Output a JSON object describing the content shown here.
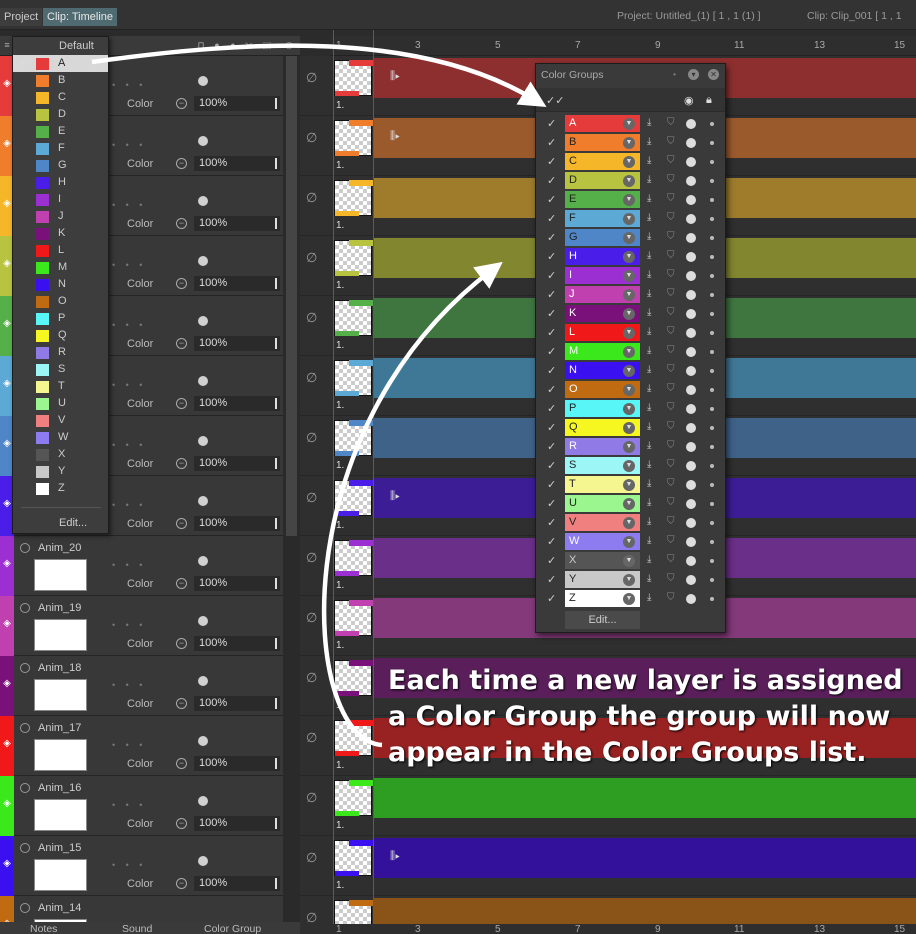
{
  "topbar": {
    "tabs": [
      "Project",
      "Clip: Timeline"
    ],
    "project_info": "Project: Untitled_(1) [ 1 , 1  (1) ]",
    "clip_info": "Clip: Clip_001 [ 1 , 1"
  },
  "ruler": {
    "ticks": [
      "1",
      "3",
      "5",
      "7",
      "9",
      "11",
      "13",
      "15"
    ]
  },
  "dropdown": {
    "default_label": "Default",
    "selected": "A",
    "items": [
      {
        "label": "A",
        "color": "#e53b3b"
      },
      {
        "label": "B",
        "color": "#f07d2b"
      },
      {
        "label": "C",
        "color": "#f5b62a"
      },
      {
        "label": "D",
        "color": "#b8c440"
      },
      {
        "label": "E",
        "color": "#56b04a"
      },
      {
        "label": "F",
        "color": "#5ba9d4"
      },
      {
        "label": "G",
        "color": "#4f86c7"
      },
      {
        "label": "H",
        "color": "#4a1ee8"
      },
      {
        "label": "I",
        "color": "#9b2fd1"
      },
      {
        "label": "J",
        "color": "#c040b0"
      },
      {
        "label": "K",
        "color": "#7a107a"
      },
      {
        "label": "L",
        "color": "#f01818"
      },
      {
        "label": "M",
        "color": "#3be81b"
      },
      {
        "label": "N",
        "color": "#3a10f0"
      },
      {
        "label": "O",
        "color": "#c06a12"
      },
      {
        "label": "P",
        "color": "#58f6f6"
      },
      {
        "label": "Q",
        "color": "#f6f620"
      },
      {
        "label": "R",
        "color": "#8f7ae6"
      },
      {
        "label": "S",
        "color": "#9cf6f6"
      },
      {
        "label": "T",
        "color": "#f6f690"
      },
      {
        "label": "U",
        "color": "#9cf690"
      },
      {
        "label": "V",
        "color": "#f08080"
      },
      {
        "label": "W",
        "color": "#8c7cf0"
      },
      {
        "label": "X",
        "color": "#555555"
      },
      {
        "label": "Y",
        "color": "#c8c8c8"
      },
      {
        "label": "Z",
        "color": "#ffffff"
      }
    ],
    "edit_label": "Edit..."
  },
  "layers": [
    {
      "name": "",
      "color": "#e53b3b",
      "blend": "Color",
      "opacity": "100%"
    },
    {
      "name": "",
      "color": "#f07d2b",
      "blend": "Color",
      "opacity": "100%"
    },
    {
      "name": "",
      "color": "#f5b62a",
      "blend": "Color",
      "opacity": "100%"
    },
    {
      "name": "",
      "color": "#b8c440",
      "blend": "Color",
      "opacity": "100%"
    },
    {
      "name": "",
      "color": "#56b04a",
      "blend": "Color",
      "opacity": "100%"
    },
    {
      "name": "",
      "color": "#5ba9d4",
      "blend": "Color",
      "opacity": "100%"
    },
    {
      "name": "",
      "color": "#4f86c7",
      "blend": "Color",
      "opacity": "100%"
    },
    {
      "name": "",
      "color": "#4a1ee8",
      "blend": "Color",
      "opacity": "100%"
    },
    {
      "name": "Anim_20",
      "color": "#9b2fd1",
      "blend": "Color",
      "opacity": "100%"
    },
    {
      "name": "Anim_19",
      "color": "#c040b0",
      "blend": "Color",
      "opacity": "100%"
    },
    {
      "name": "Anim_18",
      "color": "#7a107a",
      "blend": "Color",
      "opacity": "100%"
    },
    {
      "name": "Anim_17",
      "color": "#f01818",
      "blend": "Color",
      "opacity": "100%"
    },
    {
      "name": "Anim_16",
      "color": "#3be81b",
      "blend": "Color",
      "opacity": "100%"
    },
    {
      "name": "Anim_15",
      "color": "#3a10f0",
      "blend": "Color",
      "opacity": "100%"
    },
    {
      "name": "Anim_14",
      "color": "#c06a12",
      "blend": "",
      "opacity": ""
    }
  ],
  "timeline": {
    "frame_label": "1.",
    "bar_colors": [
      "#8e2f2f",
      "#9b5a2c",
      "#9e7c2c",
      "#82862f",
      "#3f7640",
      "#3f7896",
      "#3f6289",
      "#3c1d96",
      "#6a2f88",
      "#843a7a",
      "#5a1f5a",
      "#982222",
      "#2e9e22",
      "#33119a",
      "#8a5419"
    ]
  },
  "color_groups": {
    "title": "Color Groups",
    "edit_label": "Edit...",
    "rows": [
      {
        "label": "A",
        "color": "#e53b3b",
        "text": "#fff"
      },
      {
        "label": "B",
        "color": "#f07d2b",
        "text": "#222"
      },
      {
        "label": "C",
        "color": "#f5b62a",
        "text": "#222"
      },
      {
        "label": "D",
        "color": "#b8c440",
        "text": "#222"
      },
      {
        "label": "E",
        "color": "#56b04a",
        "text": "#222"
      },
      {
        "label": "F",
        "color": "#5ba9d4",
        "text": "#222"
      },
      {
        "label": "G",
        "color": "#4f86c7",
        "text": "#222"
      },
      {
        "label": "H",
        "color": "#4a1ee8",
        "text": "#fff"
      },
      {
        "label": "I",
        "color": "#9b2fd1",
        "text": "#fff"
      },
      {
        "label": "J",
        "color": "#c040b0",
        "text": "#fff"
      },
      {
        "label": "K",
        "color": "#7a107a",
        "text": "#fff"
      },
      {
        "label": "L",
        "color": "#f01818",
        "text": "#fff"
      },
      {
        "label": "M",
        "color": "#3be81b",
        "text": "#fff"
      },
      {
        "label": "N",
        "color": "#3a10f0",
        "text": "#fff"
      },
      {
        "label": "O",
        "color": "#c06a12",
        "text": "#fff"
      },
      {
        "label": "P",
        "color": "#58f6f6",
        "text": "#222"
      },
      {
        "label": "Q",
        "color": "#f6f620",
        "text": "#222"
      },
      {
        "label": "R",
        "color": "#8f7ae6",
        "text": "#fff"
      },
      {
        "label": "S",
        "color": "#9cf6f6",
        "text": "#222"
      },
      {
        "label": "T",
        "color": "#f6f690",
        "text": "#222"
      },
      {
        "label": "U",
        "color": "#9cf690",
        "text": "#222"
      },
      {
        "label": "V",
        "color": "#f08080",
        "text": "#222"
      },
      {
        "label": "W",
        "color": "#8c7cf0",
        "text": "#fff"
      },
      {
        "label": "X",
        "color": "#555555",
        "text": "#ccc"
      },
      {
        "label": "Y",
        "color": "#c8c8c8",
        "text": "#222"
      },
      {
        "label": "Z",
        "color": "#ffffff",
        "text": "#222"
      }
    ]
  },
  "bottom_tabs": [
    "Notes",
    "Sound",
    "Color Group"
  ],
  "annotation": {
    "line1": "Each time a new layer is assigned",
    "line2": "a Color Group the group will now",
    "line3": "appear in the Color Groups list."
  }
}
